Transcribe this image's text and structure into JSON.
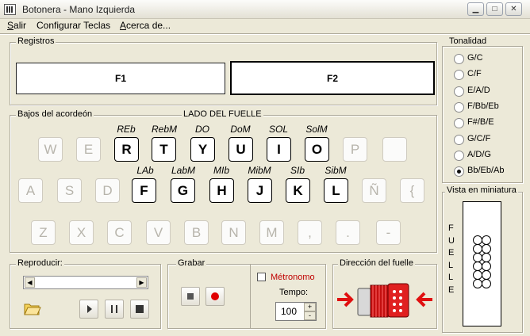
{
  "window": {
    "title": "Botonera - Mano Izquierda"
  },
  "menu": [
    {
      "label": "Salir",
      "accel": "S",
      "rest": "alir"
    },
    {
      "label": "Configurar Teclas",
      "accel": "",
      "rest": "Configurar Teclas"
    },
    {
      "label": "Acerca de...",
      "accel": "A",
      "rest": "cerca de..."
    }
  ],
  "registros": {
    "legend": "Registros",
    "f1": "F1",
    "f2": "F2"
  },
  "bajos": {
    "legend": "Bajos del acordeón",
    "side_label": "LADO DEL FUELLE",
    "row1_notes": [
      "REb",
      "RebM",
      "DO",
      "DoM",
      "SOL",
      "SolM"
    ],
    "row1_keys": [
      "W",
      "E",
      "R",
      "T",
      "Y",
      "U",
      "I",
      "O",
      "P",
      ""
    ],
    "row2_notes": [
      "LAb",
      "LabM",
      "MIb",
      "MibM",
      "SIb",
      "SibM"
    ],
    "row2_keys": [
      "A",
      "S",
      "D",
      "F",
      "G",
      "H",
      "J",
      "K",
      "L",
      "Ñ",
      "{"
    ],
    "row3_keys": [
      "Z",
      "X",
      "C",
      "V",
      "B",
      "N",
      "M",
      ",",
      ".",
      "-"
    ]
  },
  "tonalidad": {
    "legend": "Tonalidad",
    "options": [
      "G/C",
      "C/F",
      "E/A/D",
      "F/Bb/Eb",
      "F#/B/E",
      "G/C/F",
      "A/D/G",
      "Bb/Eb/Ab"
    ],
    "selected": "Bb/Eb/Ab"
  },
  "miniatura": {
    "legend": "Vista en miniatura",
    "fuelle_letters": [
      "F",
      "U",
      "E",
      "L",
      "L",
      "E"
    ]
  },
  "reproducir": {
    "legend": "Reproducir:"
  },
  "grabar": {
    "legend": "Grabar",
    "metronome_label": "Métronomo",
    "tempo_label": "Tempo:",
    "tempo_value": "100",
    "tempo_up": "+",
    "tempo_down": "-"
  },
  "direccion": {
    "legend": "Dirección del fuelle"
  },
  "colors": {
    "record_red": "#e00000",
    "metronome_text": "#c00000",
    "arrow_red": "#e01010"
  }
}
